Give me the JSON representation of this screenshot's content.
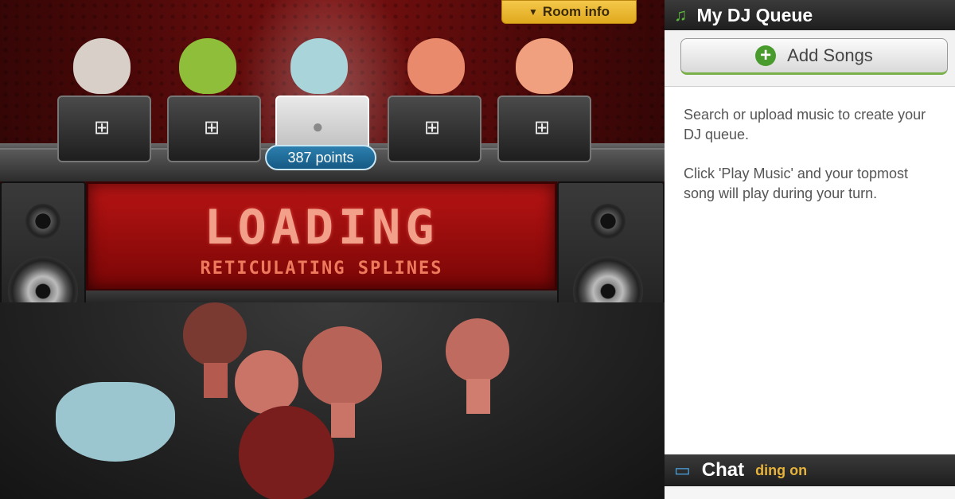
{
  "room_info_button": {
    "label": "Room info"
  },
  "stage": {
    "banner_main": "LOADING",
    "banner_sub": "RETICULATING SPLINES",
    "points_badge": "387 points",
    "djs": [
      {
        "laptop": "windows",
        "head_color": "#d9cfc9",
        "icon": "windows-logo-icon"
      },
      {
        "laptop": "windows",
        "head_color": "#8fbf3a",
        "icon": "windows-logo-icon"
      },
      {
        "laptop": "apple",
        "head_color": "#a8d4da",
        "icon": "apple-logo-icon"
      },
      {
        "laptop": "windows",
        "head_color": "#e98a6d",
        "icon": "windows-logo-icon"
      },
      {
        "laptop": "windows",
        "head_color": "#f0a07e",
        "icon": "windows-logo-icon"
      }
    ]
  },
  "sidebar": {
    "title": "My DJ Queue",
    "title_icon": "music-note-icon",
    "add_songs_label": "Add Songs",
    "help_line1": "Search or upload music to create your DJ queue.",
    "help_line2": "Click 'Play Music' and your topmost song will play during your turn.",
    "chat_title": "Chat",
    "chat_status": "ding on"
  },
  "colors": {
    "accent_green": "#4a9b2e",
    "room_info_bg": "#f0bf3a",
    "points_badge": "#1f6e9c"
  }
}
